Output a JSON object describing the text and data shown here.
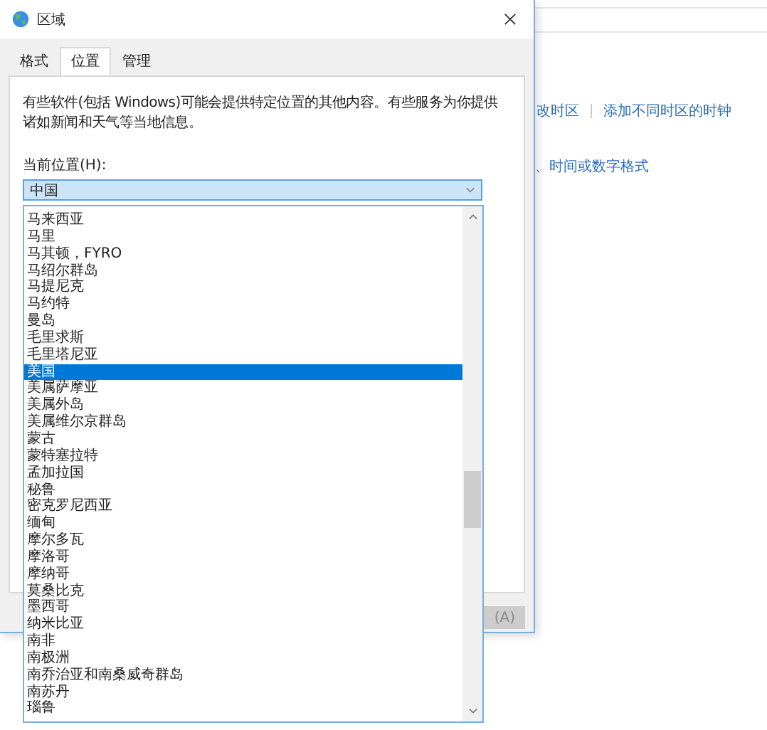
{
  "background_window": {
    "links": [
      "改时区",
      "添加不同时区的时钟"
    ],
    "second_link": "、时间或数字格式"
  },
  "window": {
    "title": "区域"
  },
  "tabs": [
    {
      "label": "格式",
      "selected": false
    },
    {
      "label": "位置",
      "selected": true
    },
    {
      "label": "管理",
      "selected": false
    }
  ],
  "description": "有些软件(包括 Windows)可能会提供特定位置的其他内容。有些服务为你提供诸如新闻和天气等当地信息。",
  "location_label": "当前位置(H):",
  "location_combo": {
    "value": "中国"
  },
  "apply_button": {
    "label": "(A)",
    "disabled": true
  },
  "dropdown": {
    "items": [
      {
        "label": "马来西亚",
        "selected": false
      },
      {
        "label": "马里",
        "selected": false
      },
      {
        "label": "马其顿，FYRO",
        "selected": false
      },
      {
        "label": "马绍尔群岛",
        "selected": false
      },
      {
        "label": "马提尼克",
        "selected": false
      },
      {
        "label": "马约特",
        "selected": false
      },
      {
        "label": "曼岛",
        "selected": false
      },
      {
        "label": "毛里求斯",
        "selected": false
      },
      {
        "label": "毛里塔尼亚",
        "selected": false
      },
      {
        "label": "美国",
        "selected": true
      },
      {
        "label": "美属萨摩亚",
        "selected": false
      },
      {
        "label": "美属外岛",
        "selected": false
      },
      {
        "label": "美属维尔京群岛",
        "selected": false
      },
      {
        "label": "蒙古",
        "selected": false
      },
      {
        "label": "蒙特塞拉特",
        "selected": false
      },
      {
        "label": "孟加拉国",
        "selected": false
      },
      {
        "label": "秘鲁",
        "selected": false
      },
      {
        "label": "密克罗尼西亚",
        "selected": false
      },
      {
        "label": "缅甸",
        "selected": false
      },
      {
        "label": "摩尔多瓦",
        "selected": false
      },
      {
        "label": "摩洛哥",
        "selected": false
      },
      {
        "label": "摩纳哥",
        "selected": false
      },
      {
        "label": "莫桑比克",
        "selected": false
      },
      {
        "label": "墨西哥",
        "selected": false
      },
      {
        "label": "纳米比亚",
        "selected": false
      },
      {
        "label": "南非",
        "selected": false
      },
      {
        "label": "南极洲",
        "selected": false
      },
      {
        "label": "南乔治亚和南桑威奇群岛",
        "selected": false
      },
      {
        "label": "南苏丹",
        "selected": false
      },
      {
        "label": "瑙鲁",
        "selected": false
      }
    ]
  }
}
